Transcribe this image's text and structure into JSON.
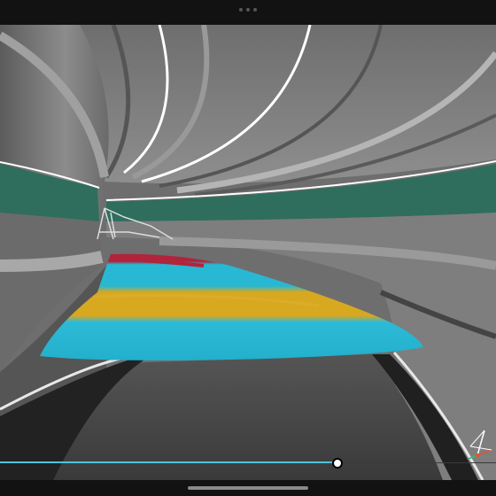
{
  "app": {
    "viewer": "3d-pipe-inspection-viewer",
    "window_grabber_icon": "ellipsis-icon",
    "axis_triad_icon": "xyz-axis-triad-icon"
  },
  "playback": {
    "progress": 0.68,
    "track_color": "#4fc3d9",
    "remaining_color": "#3a3a3a",
    "thumb_color": "#ffffff"
  },
  "colors": {
    "tunnel_wall": "#7a7a7a",
    "tunnel_band_teal": "#2f6e5c",
    "heatmap_cyan": "#28b8d4",
    "heatmap_yellow": "#d8a820",
    "heatmap_red": "#b0243c",
    "floor": "#4a4a4a"
  }
}
